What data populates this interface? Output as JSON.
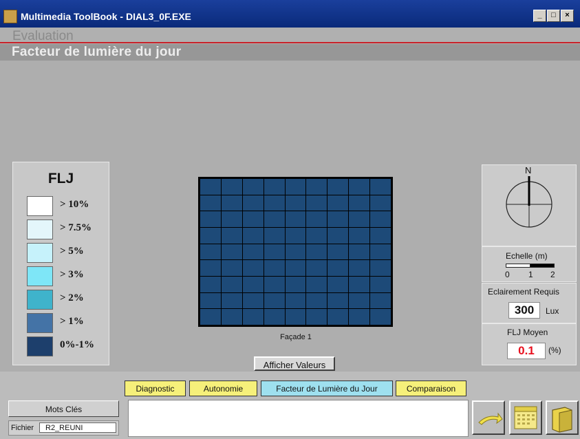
{
  "window": {
    "title": "Multimedia ToolBook - DIAL3_0F.EXE",
    "min_label": "_",
    "max_label": "□",
    "close_label": "×"
  },
  "header": {
    "section": "Evaluation",
    "subtitle": "Facteur de lumière du jour"
  },
  "legend": {
    "title": "FLJ",
    "items": [
      {
        "label": "> 10%",
        "color": "#ffffff"
      },
      {
        "label": "> 7.5%",
        "color": "#e4f6fb"
      },
      {
        "label": "> 5%",
        "color": "#c6f2fb"
      },
      {
        "label": "> 3%",
        "color": "#7ee6f7"
      },
      {
        "label": "> 2%",
        "color": "#3fb3cb"
      },
      {
        "label": "> 1%",
        "color": "#4473a6"
      },
      {
        "label": "0%-1%",
        "color": "#1d3f6c"
      }
    ]
  },
  "grid": {
    "cell_color": "#1d4a78",
    "caption": "Façade 1"
  },
  "buttons": {
    "afficher_valeurs": "Afficher Valeurs"
  },
  "compass": {
    "north_label": "N"
  },
  "scale": {
    "label": "Echelle (m)",
    "ticks": [
      "0",
      "1",
      "2"
    ]
  },
  "eclairement": {
    "label": "Eclairement Requis",
    "value": "300",
    "unit": "Lux"
  },
  "flj_moyen": {
    "label": "FLJ Moyen",
    "value": "0.1",
    "unit": "(%)"
  },
  "tabs": [
    {
      "label": "Diagnostic",
      "active": false
    },
    {
      "label": "Autonomie",
      "active": false
    },
    {
      "label": "Facteur de Lumière du Jour",
      "active": true
    },
    {
      "label": "Comparaison",
      "active": false
    }
  ],
  "footer": {
    "mots_cles": "Mots Clés",
    "fichier_label": "Fichier",
    "fichier_value": "R2_REUNI"
  },
  "colors": {
    "accent_red": "#c8222a",
    "tab_yellow": "#f6f07a",
    "tab_active": "#9ee0ef",
    "cell": "#1d4a78"
  }
}
